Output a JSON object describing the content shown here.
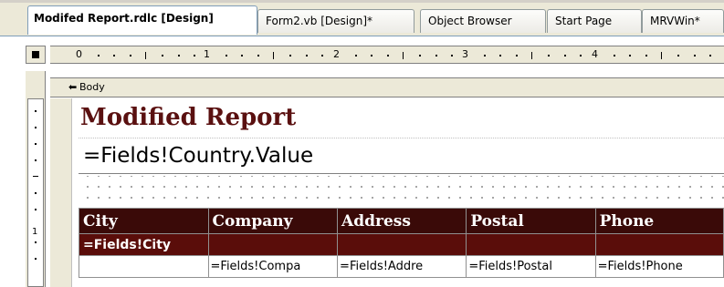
{
  "tabs": [
    {
      "label": "Modifed Report.rdlc [Design]",
      "active": true
    },
    {
      "label": "Form2.vb [Design]*",
      "active": false
    },
    {
      "label": "Object Browser",
      "active": false
    },
    {
      "label": "Start Page",
      "active": false
    },
    {
      "label": "MRVWin*",
      "active": false
    }
  ],
  "ruler": {
    "labels": [
      "0",
      "1",
      "2",
      "3",
      "4"
    ]
  },
  "vertical_ruler": {
    "label": "1"
  },
  "body_band": {
    "label": "Body"
  },
  "report": {
    "title": "Modified Report",
    "country_expr": "=Fields!Country.Value",
    "title_color": "#5a1010"
  },
  "table": {
    "headers": [
      "City",
      "Company",
      "Address",
      "Postal",
      "Phone"
    ],
    "group_row": [
      "=Fields!City",
      "",
      "",
      "",
      ""
    ],
    "detail_row": [
      "",
      "=Fields!Compa",
      "=Fields!Addre",
      "=Fields!Postal",
      "=Fields!Phone"
    ],
    "header_color": "#3a0a08",
    "group_color": "#5a0d0a"
  }
}
